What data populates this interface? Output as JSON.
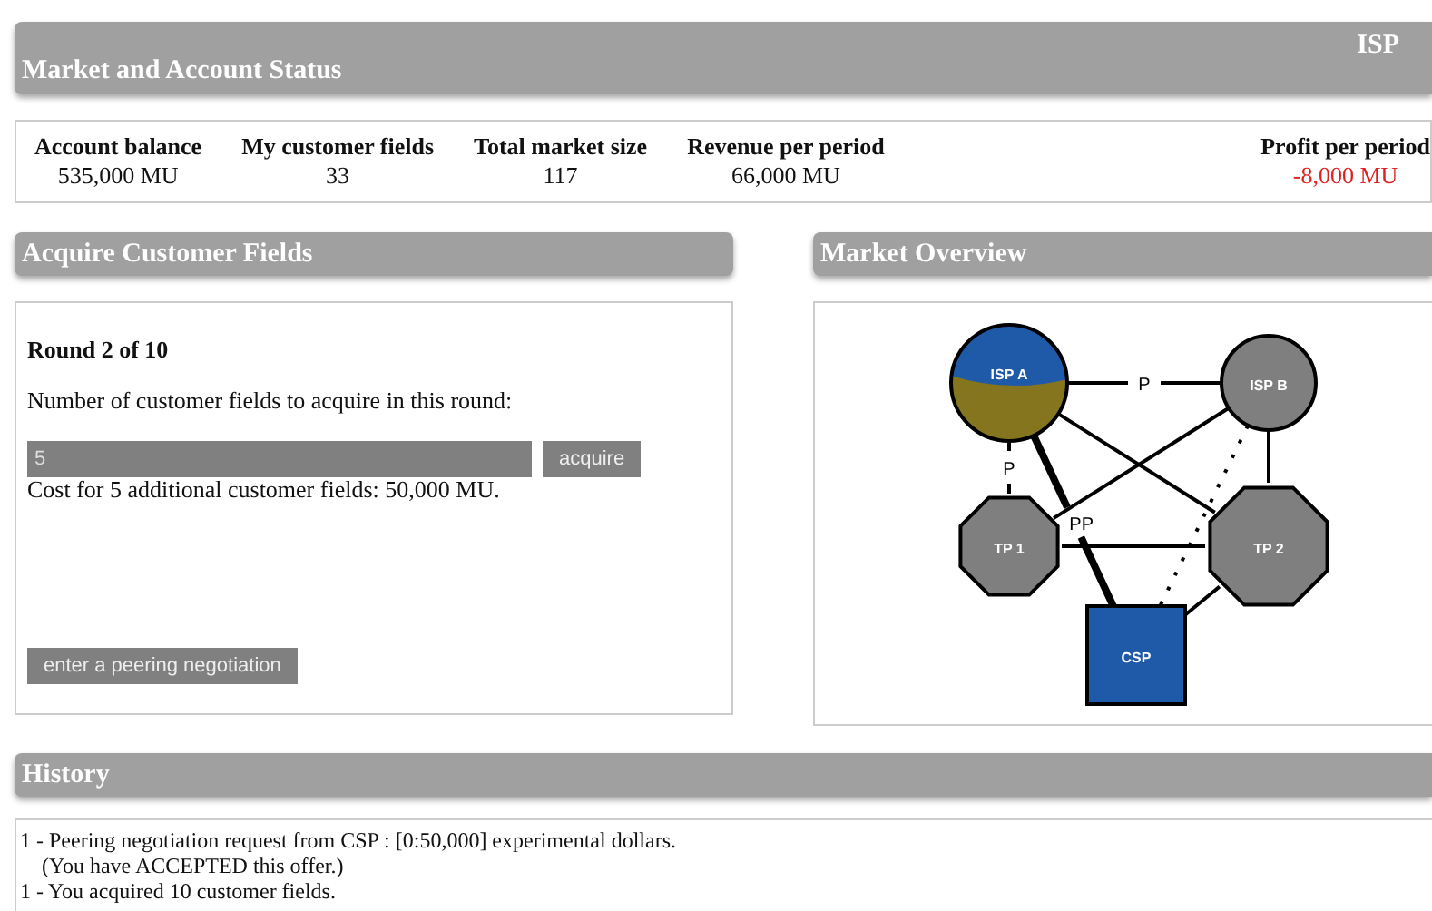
{
  "header": {
    "title": "Market and Account Status",
    "player": "ISP"
  },
  "status": [
    {
      "label": "Account balance",
      "value": "535,000 MU",
      "negative": false
    },
    {
      "label": "My customer fields",
      "value": "33",
      "negative": false
    },
    {
      "label": "Total market size",
      "value": "117",
      "negative": false
    },
    {
      "label": "Revenue per period",
      "value": "66,000 MU",
      "negative": false
    },
    {
      "label": "Profit per period",
      "value": "-8,000 MU",
      "negative": true
    }
  ],
  "acquire": {
    "title": "Acquire Customer Fields",
    "round": "Round 2 of 10",
    "prompt": "Number of customer fields to acquire in this round:",
    "amount": "5",
    "acquire_button": "acquire",
    "cost": "Cost for 5 additional customer fields:  50,000 MU.",
    "peering_button": "enter a peering negotiation"
  },
  "market": {
    "title": "Market Overview",
    "nodes": [
      {
        "label": "ISP A",
        "kind": "split-circle"
      },
      {
        "label": "ISP B",
        "kind": "circle"
      },
      {
        "label": "TP 1",
        "kind": "octagon"
      },
      {
        "label": "TP 2",
        "kind": "octagon"
      },
      {
        "label": "CSP",
        "kind": "square"
      }
    ],
    "edge_labels": [
      "P",
      "P",
      "PP"
    ]
  },
  "history": {
    "title": "History",
    "entries": [
      {
        "text": "1 - Peering negotiation request from CSP :  [0:50,000] experimental dollars.",
        "note": "(You have ACCEPTED this offer.)"
      },
      {
        "text": "1 - You acquired 10 customer fields."
      }
    ]
  }
}
